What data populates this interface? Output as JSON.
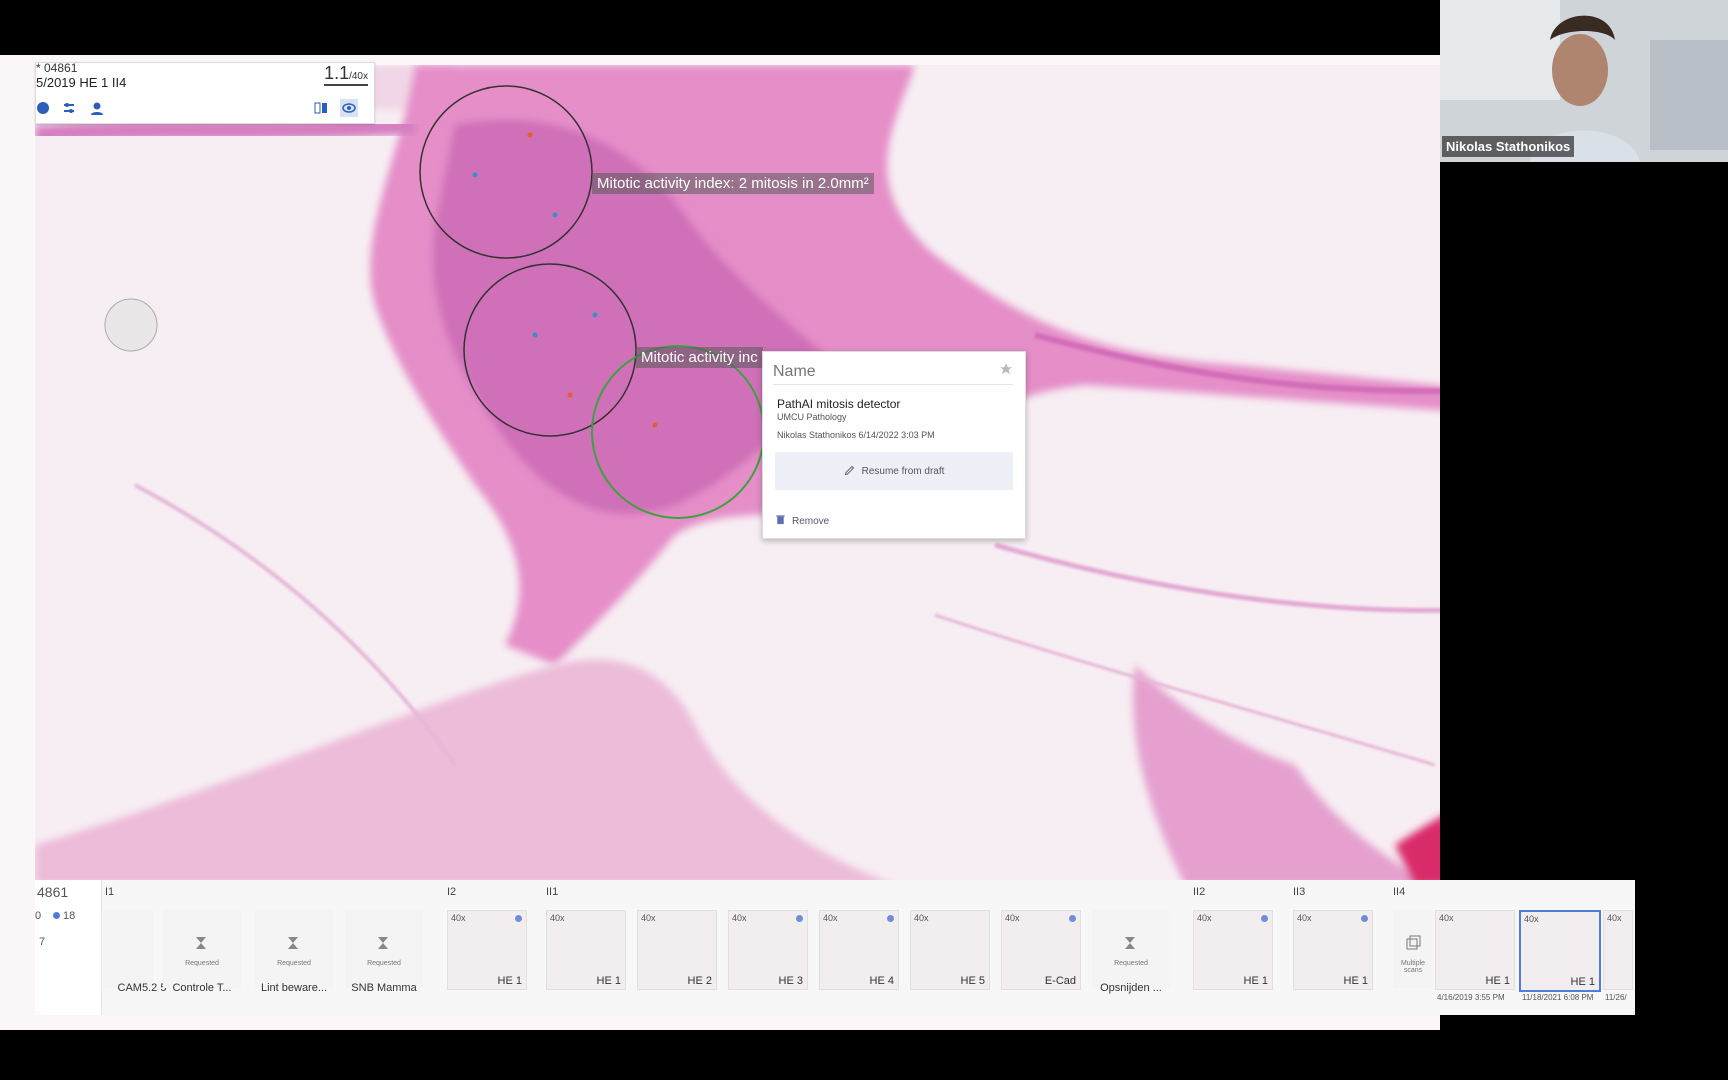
{
  "info_panel": {
    "case_id": "* 04861",
    "meta": "5/2019   HE  1   II4",
    "zoom_value": "1.1",
    "zoom_unit": "/40x"
  },
  "annotations": {
    "label_1": "Mitotic activity index: 2 mitosis in 2.0mm²",
    "label_2": "Mitotic activity inc"
  },
  "popup": {
    "name_placeholder": "Name",
    "title": "PathAI mitosis detector",
    "org": "UMCU Pathology",
    "author": "Nikolas Stathonikos  6/14/2022 3:03 PM",
    "resume_label": "Resume from draft",
    "remove_label": "Remove"
  },
  "strip": {
    "side": {
      "case": "4861",
      "count_a": "0",
      "count_b": "18",
      "count_c": "7"
    },
    "groups": [
      "I1",
      "I2",
      "II1",
      "II2",
      "II3",
      "II4"
    ],
    "requested_text": "Requested",
    "multiple_text": "Multiple scans",
    "thumbs": [
      {
        "mag": "40x",
        "label": "HE 1"
      },
      {
        "mag": "40x",
        "label": "HE 1"
      },
      {
        "mag": "40x",
        "label": "HE 2"
      },
      {
        "mag": "40x",
        "label": "HE 3"
      },
      {
        "mag": "40x",
        "label": "HE 4"
      },
      {
        "mag": "40x",
        "label": "HE 5"
      },
      {
        "mag": "40x",
        "label": "E-Cad"
      },
      {
        "mag": "40x",
        "label": "HE 1"
      },
      {
        "mag": "40x",
        "label": "HE 1"
      },
      {
        "mag": "40x",
        "label": "HE 1"
      },
      {
        "mag": "40x",
        "label": "HE 1"
      },
      {
        "mag": "40x",
        "label": ""
      }
    ],
    "requests": [
      "CAM5.2 5",
      "Controle T...",
      "Lint beware...",
      "SNB Mamma",
      "Opsnijden ..."
    ],
    "dates": [
      "4/16/2019 3:55 PM",
      "11/18/2021 6:08 PM",
      "11/26/"
    ]
  },
  "webcam": {
    "name": "Nikolas Stathonikos"
  },
  "colors": {
    "tissue_pink": "#e07ac0",
    "selection_blue": "#4d7fd9",
    "detector_green": "#3fa03f"
  }
}
